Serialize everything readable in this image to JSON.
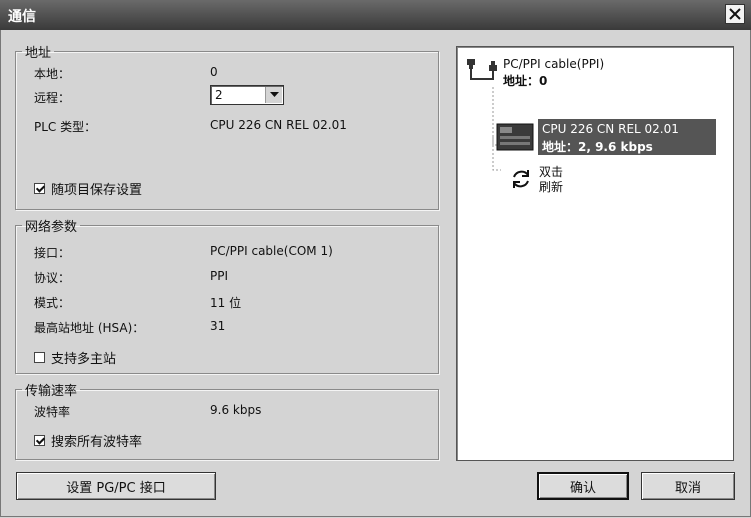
{
  "window": {
    "title": "通信"
  },
  "address": {
    "legend": "地址",
    "local_label": "本地：",
    "local_value": "0",
    "remote_label": "远程：",
    "remote_value": "2",
    "plc_type_label": "PLC 类型：",
    "plc_type_value": "CPU 226 CN REL 02.01",
    "save_settings_label": "随项目保存设置",
    "save_settings_checked": true
  },
  "network": {
    "legend": "网络参数",
    "interface_label": "接口：",
    "interface_value": "PC/PPI cable(COM 1)",
    "protocol_label": "协议：",
    "protocol_value": "PPI",
    "mode_label": "模式：",
    "mode_value": "11 位",
    "hsa_label": "最高站地址 (HSA)：",
    "hsa_value": "31",
    "multi_master_label": "支持多主站",
    "multi_master_checked": false
  },
  "baud": {
    "legend": "传输速率",
    "rate_label": "波特率",
    "rate_value": "9.6 kbps",
    "search_all_label": "搜索所有波特率",
    "search_all_checked": true
  },
  "tree": {
    "cable_name": "PC/PPI cable(PPI)",
    "cable_address": "地址：0",
    "cpu_name": "CPU 226 CN REL 02.01",
    "cpu_address": "地址：2, 9.6 kbps",
    "refresh_line1": "双击",
    "refresh_line2": "刷新"
  },
  "buttons": {
    "set_interface": "设置 PG/PC 接口",
    "ok": "确认",
    "cancel": "取消"
  }
}
